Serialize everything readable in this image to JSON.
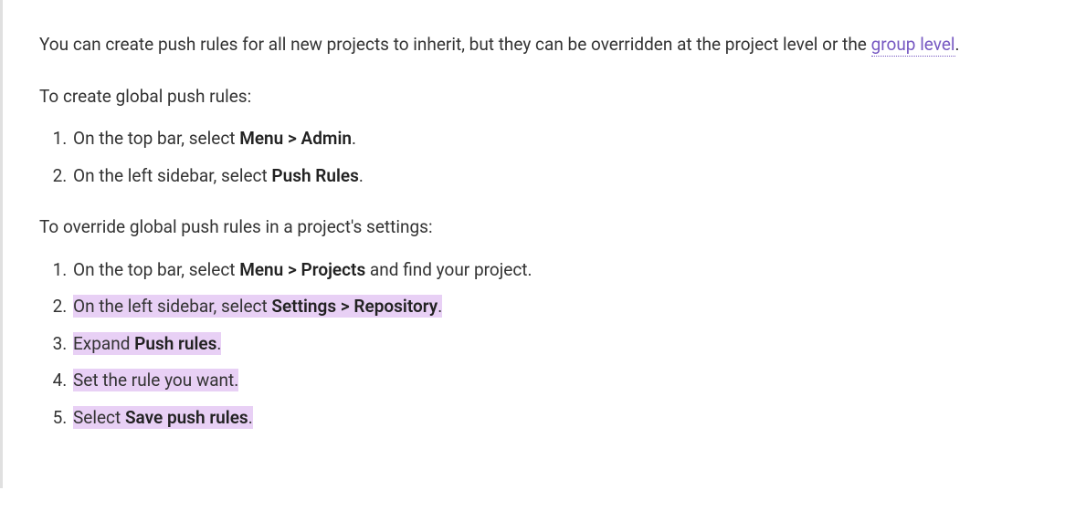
{
  "intro": {
    "text_before_link": "You can create push rules for all new projects to inherit, but they can be overridden at the project level or the ",
    "link_text": "group level",
    "text_after_link": "."
  },
  "section1": {
    "heading": "To create global push rules:",
    "items": [
      {
        "prefix": "On the top bar, select ",
        "bold1": "Menu > Admin",
        "suffix": "."
      },
      {
        "prefix": "On the left sidebar, select ",
        "bold1": "Push Rules",
        "suffix": "."
      }
    ]
  },
  "section2": {
    "heading": "To override global push rules in a project's settings:",
    "items": [
      {
        "highlighted": false,
        "prefix": "On the top bar, select ",
        "bold1": "Menu > Projects",
        "middle": " and find your project.",
        "bold2": "",
        "suffix": ""
      },
      {
        "highlighted": true,
        "prefix": "On the left sidebar, select ",
        "bold1": "Settings > Repository",
        "middle": "",
        "bold2": "",
        "suffix": "."
      },
      {
        "highlighted": true,
        "prefix": "Expand ",
        "bold1": "Push rules",
        "middle": "",
        "bold2": "",
        "suffix": "."
      },
      {
        "highlighted": true,
        "prefix": "Set the rule you want.",
        "bold1": "",
        "middle": "",
        "bold2": "",
        "suffix": ""
      },
      {
        "highlighted": true,
        "prefix": "Select ",
        "bold1": "Save push rules",
        "middle": "",
        "bold2": "",
        "suffix": "."
      }
    ]
  }
}
